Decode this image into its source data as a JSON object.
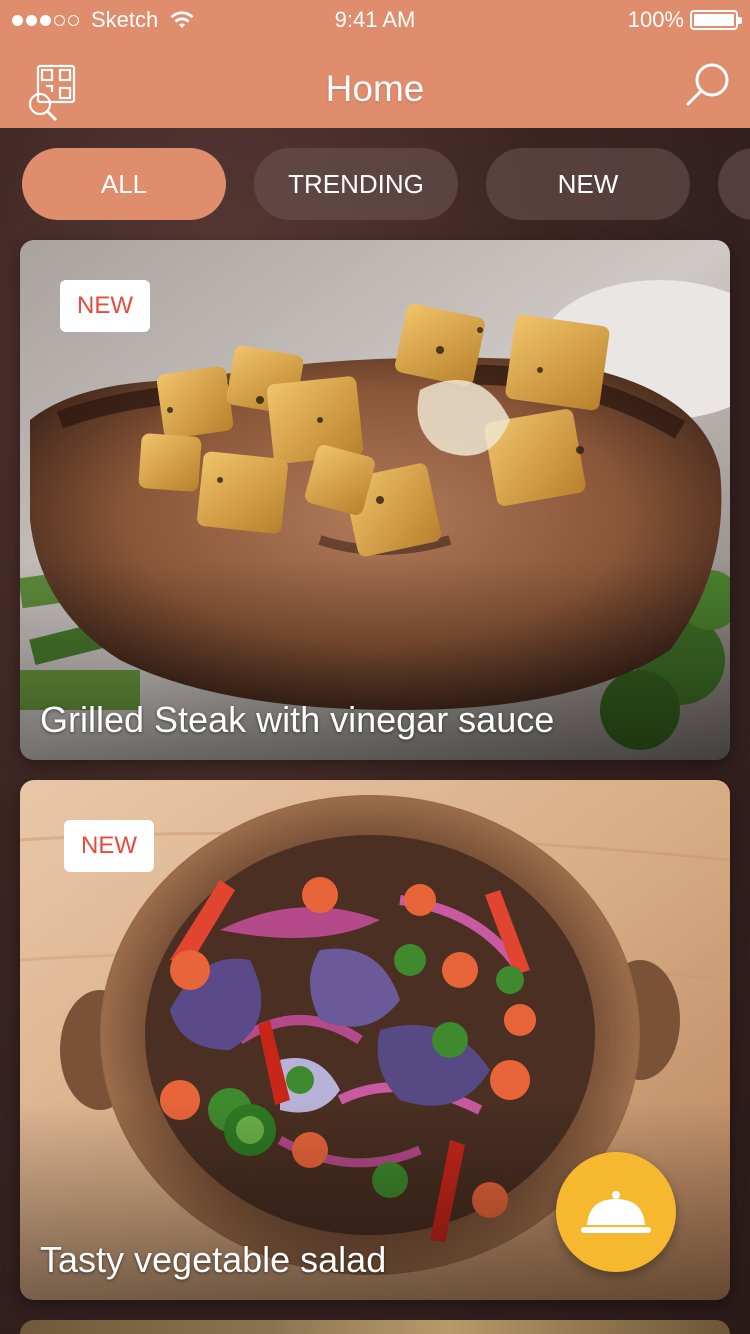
{
  "status_bar": {
    "carrier": "Sketch",
    "time": "9:41 AM",
    "battery": "100%",
    "battery_level": 1.0,
    "signal_bars_filled": 3,
    "signal_bars_total": 5
  },
  "header": {
    "title": "Home",
    "left_icon": "qr-scan-icon",
    "right_icon": "search-icon",
    "color": "#df8d6c"
  },
  "tabs": [
    {
      "label": "ALL",
      "active": true
    },
    {
      "label": "TRENDING",
      "active": false
    },
    {
      "label": "NEW",
      "active": false
    }
  ],
  "cards": [
    {
      "title": "Grilled Steak with vinegar sauce",
      "badge": "NEW"
    },
    {
      "title": "Tasty vegetable salad",
      "badge": "NEW"
    }
  ],
  "fab": {
    "icon": "serving-cloche-icon",
    "color": "#f5b82e"
  },
  "colors": {
    "accent": "#df8d6c",
    "badge_text": "#e84b3b",
    "fab": "#f5b82e"
  }
}
